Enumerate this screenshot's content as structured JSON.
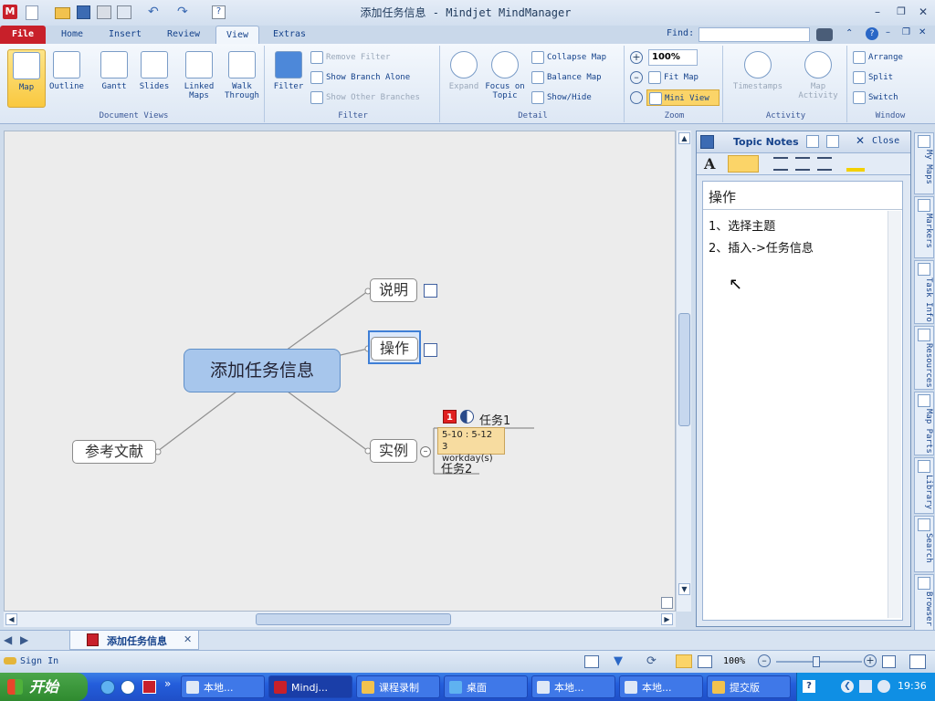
{
  "window": {
    "title": "添加任务信息 - Mindjet MindManager",
    "find_label": "Find:",
    "find_value": ""
  },
  "ribbon_tabs": [
    "File",
    "Home",
    "Insert",
    "Review",
    "View",
    "Extras"
  ],
  "ribbon": {
    "document_views": {
      "label": "Document Views",
      "buttons": [
        "Map",
        "Outline",
        "Gantt",
        "Slides",
        "Linked Maps",
        "Walk Through"
      ]
    },
    "filter": {
      "label": "Filter",
      "big": "Filter",
      "items": [
        "Remove Filter",
        "Show Branch Alone",
        "Show Other Branches"
      ]
    },
    "detail": {
      "label": "Detail",
      "expand": "Expand",
      "focus": "Focus on Topic",
      "items": [
        "Collapse Map",
        "Balance Map",
        "Show/Hide"
      ]
    },
    "zoom": {
      "label": "Zoom",
      "value": "100%",
      "fit_map": "Fit Map",
      "mini_view": "Mini View"
    },
    "activity": {
      "label": "Activity",
      "timestamps": "Timestamps",
      "map_activity": "Map Activity"
    },
    "window": {
      "label": "Window",
      "items": [
        "Arrange",
        "Split",
        "Switch"
      ]
    }
  },
  "map": {
    "central": "添加任务信息",
    "topics": {
      "shuoming": "说明",
      "caozuo": "操作",
      "shili": "实例",
      "cankao": "参考文献"
    },
    "subtopics": {
      "task1": "任务1",
      "task1_priority": "1",
      "task1_dates": "5-10 : 5-12",
      "task1_duration": "3 workday(s)",
      "task2": "任务2"
    }
  },
  "notes": {
    "title": "Topic Notes",
    "close": "Close",
    "heading": "操作",
    "lines": [
      "1、选择主题",
      "2、插入->任务信息"
    ]
  },
  "sidebar_tabs": [
    "My Maps",
    "Markers",
    "Task Info",
    "Resources",
    "Map Parts",
    "Library",
    "Search",
    "Browser"
  ],
  "doc_tab": "添加任务信息",
  "status": {
    "sign_in": "Sign In",
    "zoom": "100%"
  },
  "taskbar": {
    "start": "开始",
    "tasks": [
      "本地...",
      "Mindj...",
      "课程录制",
      "桌面",
      "本地...",
      "本地...",
      "提交版"
    ],
    "clock": "19:36"
  },
  "colors": {
    "central_fill": "#a7c6ec",
    "selected_border": "#3f7fd6",
    "file_tab": "#c8202a",
    "task_bar": "#245edb"
  }
}
